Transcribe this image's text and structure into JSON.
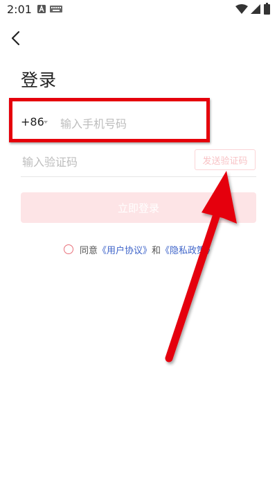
{
  "status_bar": {
    "time": "2:01",
    "icons": [
      "android-icon",
      "keyboard-icon",
      "wifi-icon",
      "signal-icon",
      "battery-icon"
    ]
  },
  "nav": {
    "back_icon": "chevron-left-icon"
  },
  "title": "登录",
  "phone": {
    "country_code": "+86",
    "placeholder": "输入手机号码",
    "value": ""
  },
  "code": {
    "placeholder": "输入验证码",
    "value": "",
    "send_label": "发送验证码"
  },
  "login_label": "立即登录",
  "agreement": {
    "prefix": "同意",
    "user_agreement": "《用户协议》",
    "and": "和",
    "privacy_policy": "《隐私政策》"
  },
  "colors": {
    "annotation_red": "#e5000b",
    "login_button_disabled": "#fde4e6",
    "link_blue": "#3d63c9",
    "send_code_disabled": "#f8c3c6"
  }
}
